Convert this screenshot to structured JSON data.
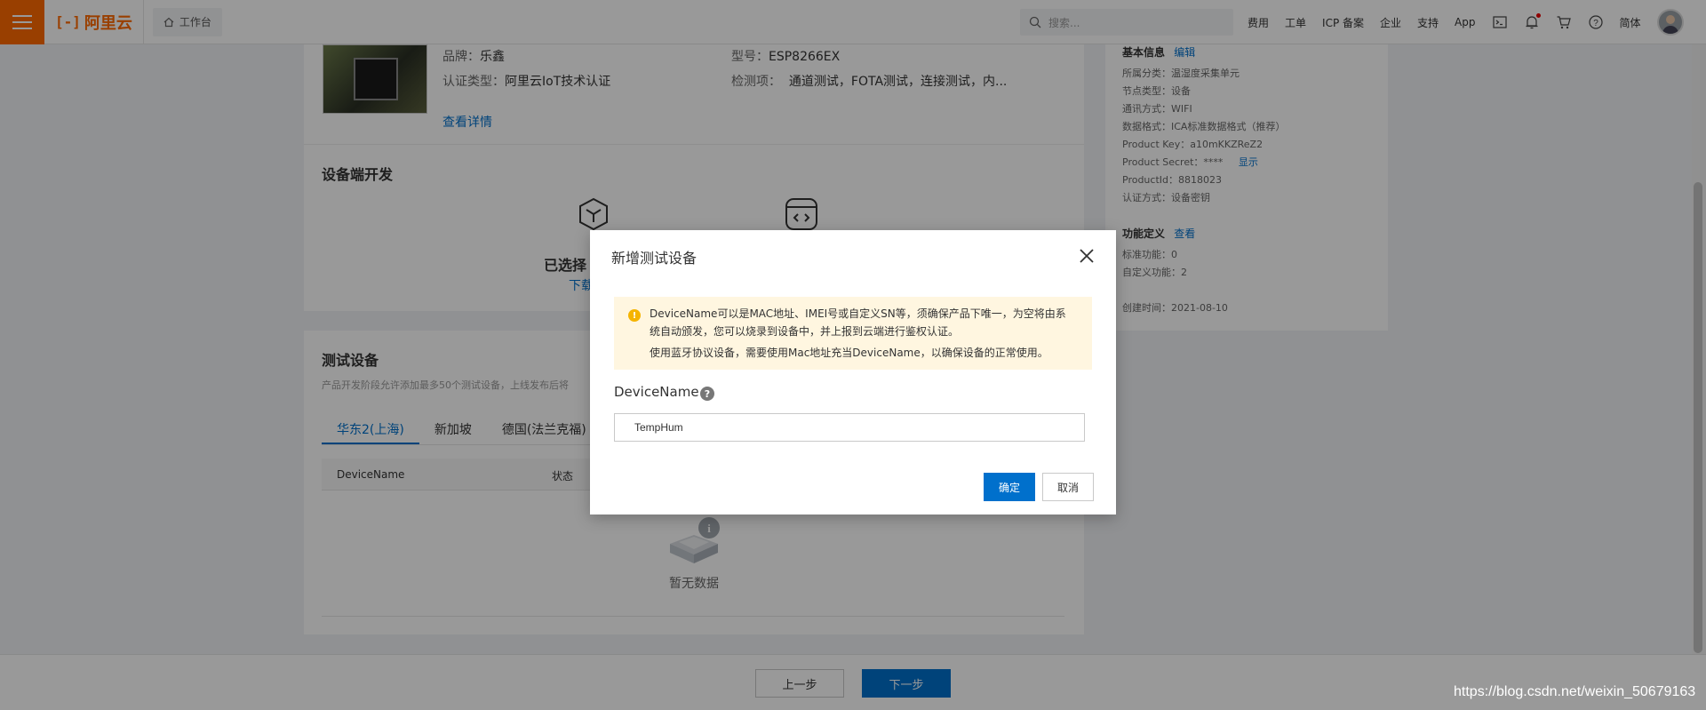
{
  "topbar": {
    "logo_mark": "[-]",
    "logo_text": "阿里云",
    "workbench": "工作台",
    "search_placeholder": "搜索...",
    "nav": [
      "费用",
      "工单",
      "ICP 备案",
      "企业",
      "支持",
      "App"
    ],
    "lang": "简体"
  },
  "product": {
    "brand_label": "品牌：",
    "brand_value": "乐鑫",
    "model_label": "型号：",
    "model_value": "ESP8266EX",
    "cert_label": "认证类型：",
    "cert_value": "阿里云IoT技术认证",
    "test_label": "检测项：",
    "test_value": "通道测试，FOTA测试，连接测试，内...",
    "detail_link": "查看详情"
  },
  "device_dev": {
    "title": "设备端开发",
    "selected_text": "已选择",
    "download_text": "下载"
  },
  "test_devices": {
    "title": "测试设备",
    "hint": "产品开发阶段允许添加最多50个测试设备，上线发布后将",
    "tabs": [
      "华东2(上海)",
      "新加坡",
      "德国(法兰克福)"
    ],
    "columns": [
      "DeviceName",
      "状态"
    ],
    "empty_text": "暂无数据"
  },
  "info": {
    "basic_title": "基本信息",
    "edit_link": "编辑",
    "lines": [
      "所属分类：温湿度采集单元",
      "节点类型：设备",
      "通讯方式：WIFI",
      "数据格式：ICA标准数据格式（推荐）",
      "Product Key：a10mKKZReZ2"
    ],
    "secret_label": "Product Secret：****",
    "secret_show": "显示",
    "lines2": [
      "ProductId：8818023",
      "认证方式：设备密钥"
    ],
    "func_title": "功能定义",
    "func_link": "查看",
    "func_lines": [
      "标准功能：0",
      "自定义功能：2"
    ],
    "created": "创建时间：2021-08-10"
  },
  "footer": {
    "prev": "上一步",
    "next": "下一步"
  },
  "modal": {
    "title": "新增测试设备",
    "notice_line1": "DeviceName可以是MAC地址、IMEI号或自定义SN等，须确保产品下唯一，为空将由系统自动颁发，您可以烧录到设备中，并上报到云端进行鉴权认证。",
    "notice_line2": "使用蓝牙协议设备，需要使用Mac地址充当DeviceName，以确保设备的正常使用。",
    "field_label": "DeviceName",
    "field_value": "TempHum",
    "ok": "确定",
    "cancel": "取消"
  },
  "watermark": "https://blog.csdn.net/weixin_50679163",
  "colors": {
    "brand": "#ff6a00",
    "primary": "#0070cc",
    "notice_bg": "#fff6e0",
    "notice_icon": "#f5b400"
  }
}
